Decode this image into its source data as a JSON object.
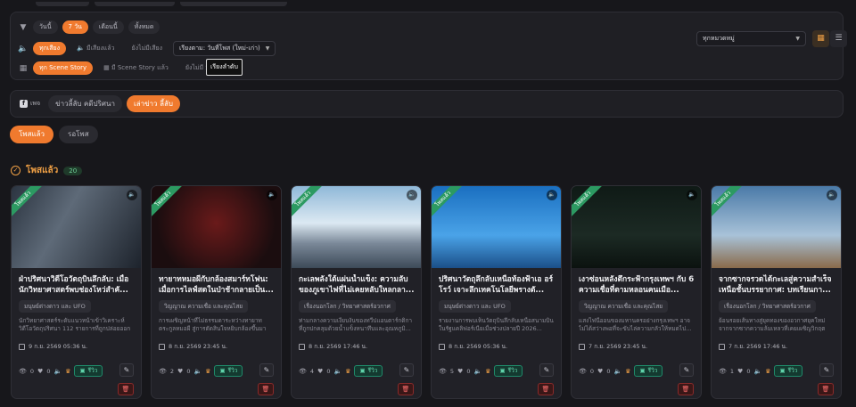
{
  "filters": {
    "time_pills": [
      "วันนี้",
      "7 วัน",
      "เดือนนี้",
      "ทั้งหมด"
    ],
    "time_active": 1,
    "sound_pills": [
      "ทุกเสียง",
      "มีเสียงแล้ว",
      "ยังไม่มีเสียง"
    ],
    "sound_active": 0,
    "sort_select": "เรียงตาม: วันที่โพส (ใหม่-เก่า)",
    "scene_pills": [
      "ทุก Scene Story",
      "มี Scene Story แล้ว",
      "ยังไม่มี Sce"
    ],
    "scene_active": 0,
    "tooltip": "เรียงลำดับ",
    "category_select": "ทุกหมวดหมู่"
  },
  "page_bar": {
    "fb_label": "เพจ",
    "pages": [
      "ข่าวลี้ลับ คดีปริศนา",
      "เล่าข่าว ลี้ลับ"
    ],
    "active": 1
  },
  "tabs": [
    "โพสแล้ว",
    "รอโพส"
  ],
  "tab_active": 0,
  "section": {
    "title": "โพสแล้ว",
    "count": "20"
  },
  "ribbon_label": "โพสแล้ว",
  "review_label": "รีวิว",
  "cards": [
    {
      "title": "ฝ่าปริศนาวิดีโอวัตถุบินลึกลับ: เมื่อนักวิทยาศาสตร์พบช่องโหว่สำคั...",
      "category": "มนุษย์ต่างดาว และ UFO",
      "desc": "นักวิทยาศาสตร์ระดับแนวหน้าเข้าวิเคราะห์วิดีโอวัตถุปริศนา 112 รายการที่ถูกปล่อยออกโดยบ...",
      "date": "9 ก.ย. 2569 05:36 น.",
      "views": "0",
      "likes": "0"
    },
    {
      "title": "ทายาทหมอผีกับกล้องสมาร์ทโฟน: เมื่อการไลฟ์สดในป่าช้ากลายเป็น...",
      "category": "วิญญาณ ความเชื่อ และคุณไสย",
      "desc": "การเผชิญหน้าที่ไม่ธรรมดาระหว่างทายาทตระกูลหมอผี สู่การตัดสินใจหยิบกล้องขึ้นมาบันทึกภาพ...",
      "date": "8 ก.ย. 2569 23:45 น.",
      "views": "2",
      "likes": "0"
    },
    {
      "title": "กะเลพลังใต้แผ่นน้ำแข็ง: ความลับของภูเขาไฟที่ไม่เคยหลับใหลกลา...",
      "category": "เรื่องนอกโลก / วิทยาศาสตร์อวกาศ",
      "desc": "ท่ามกลางความเงียบงันของทวีปแอนตาร์กติกา ที่ถูกปกคลุมด้วยน้ำแข็งหนาทึบและอุณหภูมิ...",
      "date": "8 ก.ย. 2569 17:46 น.",
      "views": "4",
      "likes": "0"
    },
    {
      "title": "ปริศนาวัตถุลึกลับเหนือท้องฟ้าเอ อร์โรว์ เจาะลึกเทคโนโลยีพรางตั...",
      "category": "มนุษย์ต่างดาว และ UFO",
      "desc": "รายงานการพบเห็นวัตถุบินลึกลับเหนือสนามบินในรัฐแคลิฟอร์เนียเมื่อช่วงปลายปี 2026...",
      "date": "8 ก.ย. 2569 05:36 น.",
      "views": "5",
      "likes": "0"
    },
    {
      "title": "เงาซ่อนหลังตึกระฟ้ากรุงเทพฯ กับ 6 ความเชื่อที่ตามหลอนคนเมือ...",
      "category": "วิญญาณ ความเชื่อ และคุณไสย",
      "desc": "แสงไฟนีออนของมหานครอย่างกรุงเทพฯ อาจไม่ได้สว่างพอที่จะขับไล่ความกลัวให้หมดไป...",
      "date": "7 ก.ย. 2569 23:45 น.",
      "views": "0",
      "likes": "0"
    },
    {
      "title": "จากซากจรวดได้กะเลสู่ความสำเร็จเหนือชั้นบรรยากาศ: บทเรียนกา...",
      "category": "เรื่องนอกโลก / วิทยาศาสตร์อวกาศ",
      "desc": "ย้อนรอยเส้นทางสู่ยุคทองของอวกาศยุคใหม่ จากจากซากความล้มเหลวที่เคยเผชิญวิกฤตรุนแรง...",
      "date": "7 ก.ย. 2569 17:46 น.",
      "views": "1",
      "likes": "0"
    }
  ]
}
